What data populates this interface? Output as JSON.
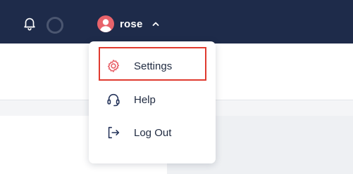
{
  "header": {
    "username": "rose",
    "icons": {
      "notifications": "bell-icon",
      "status": "status-ring-icon",
      "avatar": "user-avatar-icon",
      "toggle": "chevron-up-icon"
    },
    "colors": {
      "background": "#1e2b4a",
      "avatar": "#e8636b"
    }
  },
  "user_menu": {
    "items": [
      {
        "label": "Settings",
        "icon": "gear-icon",
        "highlighted": true
      },
      {
        "label": "Help",
        "icon": "headset-icon"
      },
      {
        "label": "Log Out",
        "icon": "logout-icon"
      }
    ],
    "highlight_color": "#e03a2f"
  }
}
